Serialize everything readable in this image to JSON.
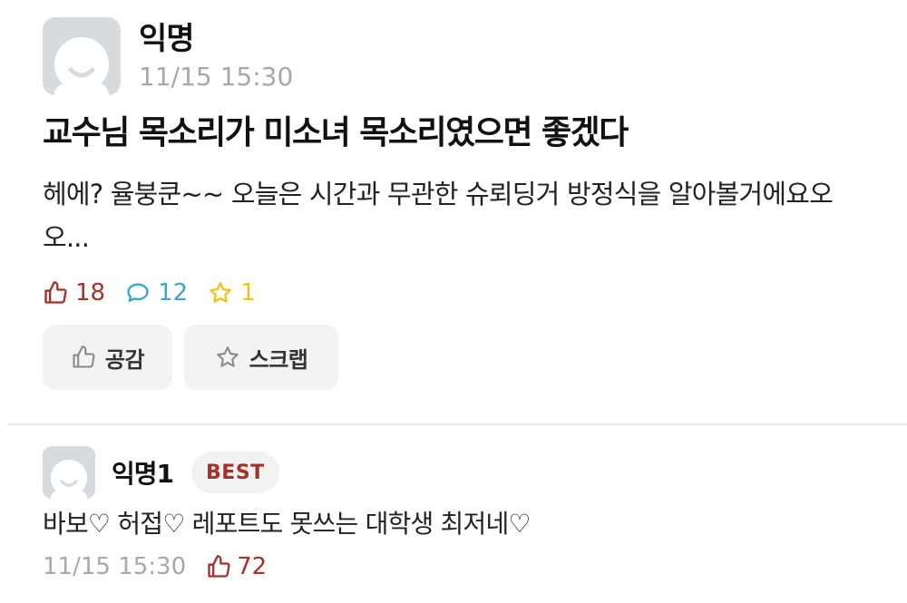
{
  "post": {
    "author": "익명",
    "time": "11/15 15:30",
    "title": "교수님 목소리가 미소녀 목소리였으면 좋겠다",
    "body": "헤에? 율붕쿤~~ 오늘은 시간과 무관한 슈뢰딩거 방정식을 알아볼거에요오오...",
    "stats": {
      "likes": "18",
      "comments": "12",
      "scraps": "1"
    },
    "like_button_label": "공감",
    "scrap_button_label": "스크랩"
  },
  "comment": {
    "author": "익명1",
    "badge": "BEST",
    "body": "바보♡ 허접♡ 레포트도 못쓰는 대학생 최저네♡",
    "time": "11/15 15:30",
    "likes": "72"
  },
  "colors": {
    "like": "#a5322a",
    "comment": "#3aa7c4",
    "scrap": "#f1c21b",
    "muted": "#a8a8a8",
    "avatar_bg": "#d8dbde"
  },
  "icons": [
    "avatar-icon",
    "thumbs-up-icon",
    "comment-icon",
    "star-icon"
  ]
}
